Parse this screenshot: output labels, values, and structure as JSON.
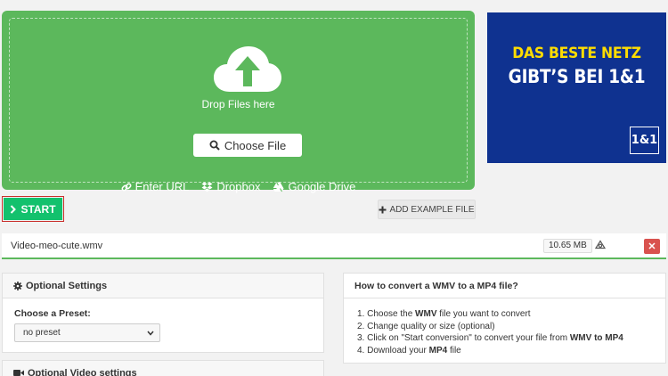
{
  "upload": {
    "drop_text": "Drop Files here",
    "choose_label": "Choose File",
    "sources": {
      "url": "Enter URL",
      "dropbox": "Dropbox",
      "gdrive": "Google Drive"
    },
    "bg_color": "#5cb85c"
  },
  "ad": {
    "line1": "DAS BESTE NETZ",
    "line2": "GIBT’S BEI 1&1",
    "logo": "1&1"
  },
  "actions": {
    "start_label": "START",
    "example_label": "ADD EXAMPLE FILE"
  },
  "file": {
    "name": "Video-meo-cute.wmv",
    "size": "10.65 MB"
  },
  "optional_settings": {
    "title": "Optional Settings",
    "preset_label": "Choose a Preset:",
    "preset_value": "no preset"
  },
  "video_settings": {
    "title": "Optional Video settings"
  },
  "howto": {
    "title": "How to convert a WMV to a MP4 file?",
    "steps": {
      "s1_pre": "1. Choose the ",
      "s1_b": "WMV",
      "s1_post": " file you want to convert",
      "s2": "2. Change quality or size (optional)",
      "s3_pre": "3. Click on \"Start conversion\" to convert your file from ",
      "s3_b": "WMV to MP4",
      "s4_pre": "4. Download your ",
      "s4_b": "MP4",
      "s4_post": " file"
    }
  }
}
